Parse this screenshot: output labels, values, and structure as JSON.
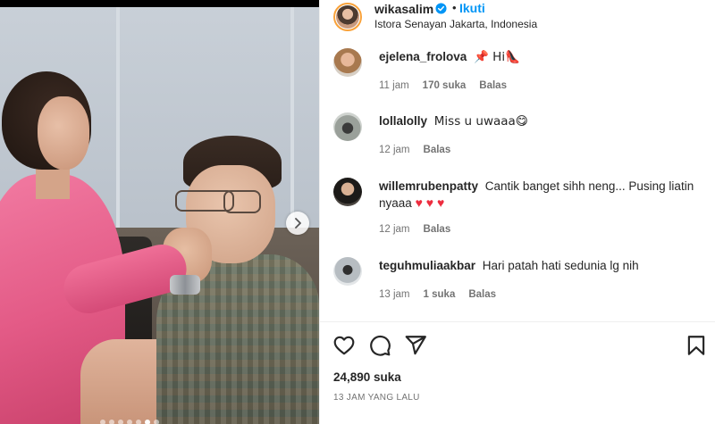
{
  "post": {
    "username": "wikasalim",
    "follow_label": "Ikuti",
    "separator": "•",
    "location": "Istora Senayan Jakarta, Indonesia",
    "likes": "24,890 suka",
    "time_ago": "13 JAM YANG LALU"
  },
  "comments": [
    {
      "user": "ejelena_frolova",
      "text": "📌 Hi👠",
      "time": "11 jam",
      "likes": "170 suka",
      "reply": "Balas"
    },
    {
      "user": "lollalolly",
      "text": "Miss u uwaaa😋",
      "time": "12 jam",
      "likes": "",
      "reply": "Balas"
    },
    {
      "user": "willemrubenpatty",
      "text": "Cantik banget sihh neng... Pusing liatin nyaaa",
      "hearts": "♥ ♥ ♥",
      "time": "12 jam",
      "likes": "",
      "reply": "Balas"
    },
    {
      "user": "teguhmuliaakbar",
      "text": "Hari patah hati sedunia lg nih",
      "time": "13 jam",
      "likes": "1 suka",
      "reply": "Balas"
    }
  ],
  "icons": {
    "like": "heart-icon",
    "comment": "comment-icon",
    "share": "send-icon",
    "save": "bookmark-icon",
    "verified": "verified-badge-icon",
    "next": "chevron-right-icon"
  },
  "colors": {
    "accent": "#0095f6",
    "text": "#262626",
    "muted": "#737373",
    "heart": "#ed2d3f"
  }
}
